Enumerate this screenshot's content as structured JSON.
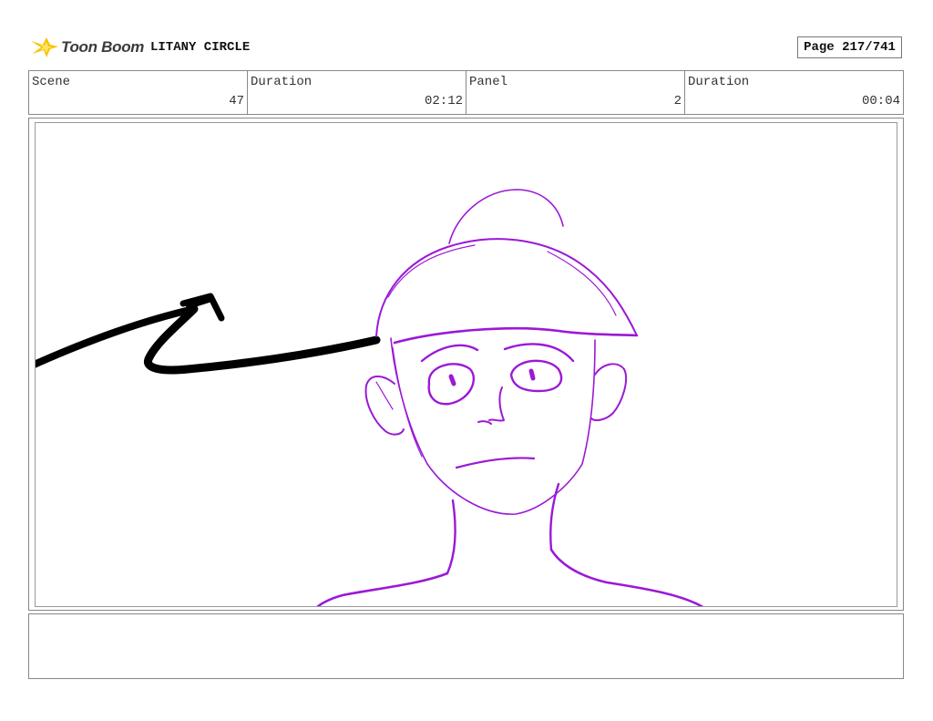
{
  "header": {
    "logo_text": "Toon Boom",
    "project_title": "LITANY CIRCLE",
    "page_counter": "Page 217/741"
  },
  "info": {
    "scene_label": "Scene",
    "scene_value": "47",
    "scene_duration_label": "Duration",
    "scene_duration_value": "02:12",
    "panel_label": "Panel",
    "panel_value": "2",
    "panel_duration_label": "Duration",
    "panel_duration_value": "00:04"
  },
  "colors": {
    "sketch_stroke": "#9b19d6",
    "arrow_stroke": "#000000",
    "logo_flare": "#f5c400"
  }
}
